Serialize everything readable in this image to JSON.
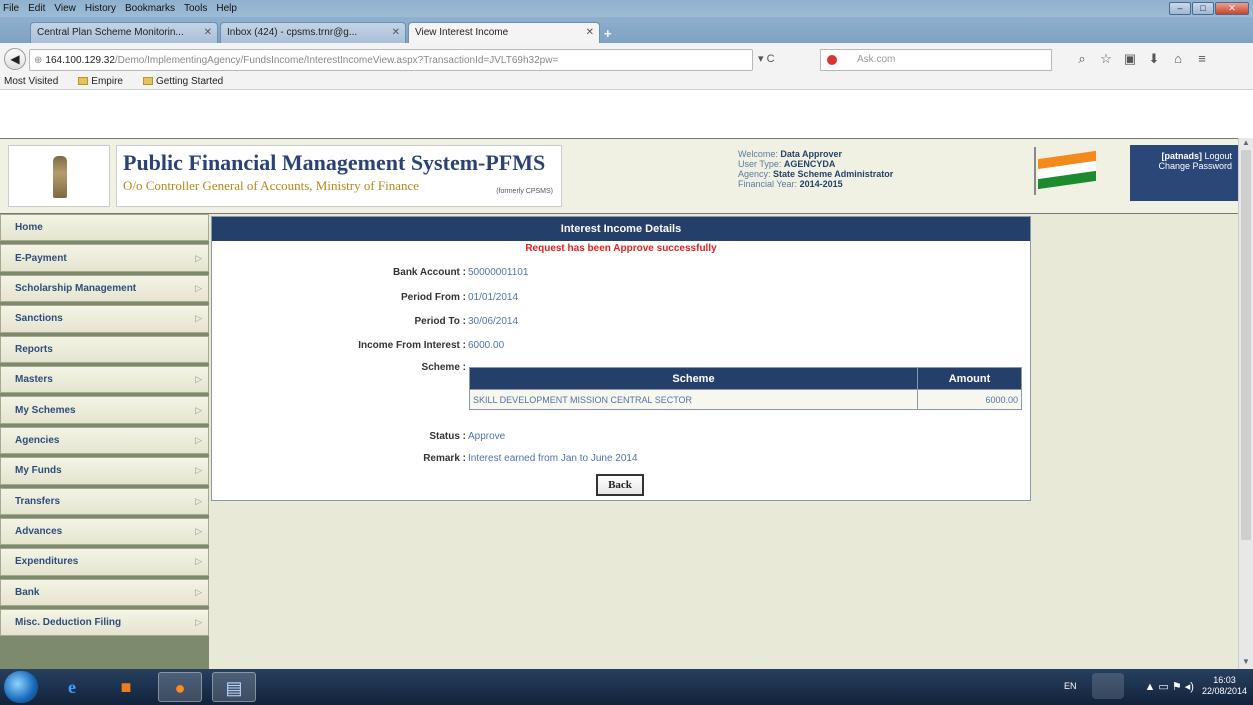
{
  "browser": {
    "menu": [
      "File",
      "Edit",
      "View",
      "History",
      "Bookmarks",
      "Tools",
      "Help"
    ],
    "tabs": [
      {
        "label": "Central Plan Scheme Monitorin..."
      },
      {
        "label": "Inbox (424) - cpsms.trnr@g..."
      },
      {
        "label": "View Interest Income"
      }
    ],
    "url_host": "164.100.129.32",
    "url_path": "/Demo/ImplementingAgency/FundsIncome/InterestIncomeView.aspx?TransactionId=JVLT69h32pw=",
    "search_placeholder": "Ask.com",
    "bookmarks": [
      "Most Visited",
      "Empire",
      "Getting Started"
    ]
  },
  "header": {
    "title": "Public Financial Management System-PFMS",
    "subtitle": "O/o Controller General of Accounts, Ministry of Finance",
    "small_tag": "(formerly CPSMS)",
    "welcome_label": "Welcome:",
    "welcome_value": "Data Approver",
    "usertype_label": "User Type:",
    "usertype_value": "AGENCYDA",
    "agency_label": "Agency:",
    "agency_value": "State Scheme Administrator",
    "fy_label": "Financial Year:",
    "fy_value": "2014-2015",
    "username": "[patnads]",
    "logout": "Logout",
    "change_password": "Change Password"
  },
  "sidebar": {
    "items": [
      {
        "label": "Home",
        "has_arrow": false
      },
      {
        "label": "E-Payment",
        "has_arrow": true
      },
      {
        "label": "Scholarship Management",
        "has_arrow": true
      },
      {
        "label": "Sanctions",
        "has_arrow": true
      },
      {
        "label": "Reports",
        "has_arrow": false
      },
      {
        "label": "Masters",
        "has_arrow": true
      },
      {
        "label": "My Schemes",
        "has_arrow": true
      },
      {
        "label": "Agencies",
        "has_arrow": true
      },
      {
        "label": "My Funds",
        "has_arrow": true
      },
      {
        "label": "Transfers",
        "has_arrow": true
      },
      {
        "label": "Advances",
        "has_arrow": true
      },
      {
        "label": "Expenditures",
        "has_arrow": true
      },
      {
        "label": "Bank",
        "has_arrow": true
      },
      {
        "label": "Misc. Deduction Filing",
        "has_arrow": true
      }
    ]
  },
  "panel": {
    "title": "Interest Income Details",
    "message": "Request has been Approve successfully",
    "fields": [
      {
        "label": "Bank Account :",
        "value": "50000001101"
      },
      {
        "label": "Period From :",
        "value": "01/01/2014"
      },
      {
        "label": "Period To :",
        "value": "30/06/2014"
      },
      {
        "label": "Income From Interest :",
        "value": "6000.00"
      },
      {
        "label": "Scheme :",
        "value": ""
      }
    ],
    "table": {
      "headers": [
        "Scheme",
        "Amount"
      ],
      "rows": [
        [
          "SKILL DEVELOPMENT MISSION CENTRAL SECTOR",
          "6000.00"
        ]
      ]
    },
    "status_label": "Status :",
    "status_value": "Approve",
    "remark_label": "Remark :",
    "remark_value": "Interest earned from Jan to June 2014",
    "back_button": "Back"
  },
  "taskbar": {
    "lang": "EN",
    "time": "16:03",
    "date": "22/08/2014"
  }
}
